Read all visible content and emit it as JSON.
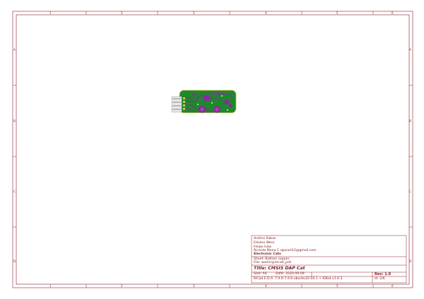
{
  "frame": {
    "columns": [
      "1",
      "2",
      "3",
      "4",
      "5",
      "6"
    ],
    "rows": [
      "A",
      "B",
      "C",
      "D"
    ],
    "line_color": "#8a1c26"
  },
  "title_block": {
    "authors": [
      "Andres Sabas",
      "Eduaro Wero",
      "Felipe Islas",
      "Ricardo Mena C rgacort12@gmail.com"
    ],
    "company": "Electronic Cats",
    "sheet_label": "Sheet: Bottom copper",
    "file_label": "File: working.kicad_pcb",
    "title": "Title: CMSIS DAP Cat",
    "size": "Size: A4",
    "date": "Date: 2020-09-09",
    "rev": "Rev: 1.0",
    "tool": "KiCad E.D.A.  7.0.6-7.0.6-ubuntu22.04.1 + KiBot v1.6.3",
    "id": "Id: 2/6"
  },
  "pcb": {
    "board_color": "#1c8a2a",
    "copper_color": "#8a2a9c",
    "outline_color": "#d8c24a"
  }
}
